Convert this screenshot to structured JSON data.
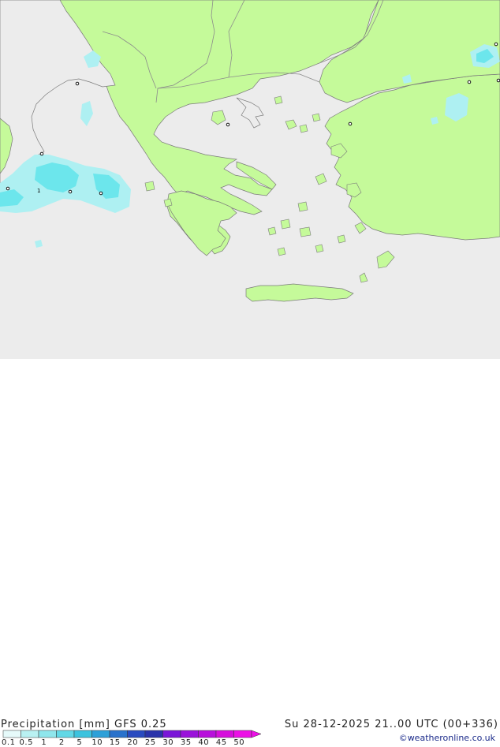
{
  "map": {
    "region": "Greece / Aegean / Western Turkey",
    "colors": {
      "sea": "#ececec",
      "land": "#c5fa9a",
      "border": "#8c8c8c",
      "coast": "#7a7a7a",
      "precip_light": "#aef0f2",
      "precip_medium": "#6ce6ec"
    },
    "markers": [
      "o",
      "o",
      "o",
      "o",
      "1",
      "o",
      "o",
      "o",
      "o",
      "o"
    ]
  },
  "footer": {
    "title": "Precipitation [mm]  GFS 0.25",
    "datetime": "Su 28-12-2025 21..00 UTC (00+336)",
    "credit": "©weatheronline.co.uk"
  },
  "legend": {
    "ticks": [
      "0.1",
      "0.5",
      "1",
      "2",
      "5",
      "10",
      "15",
      "20",
      "25",
      "30",
      "35",
      "40",
      "45",
      "50"
    ],
    "colors": [
      "#e6fafa",
      "#b9f1f2",
      "#8fe6ec",
      "#62d8e6",
      "#3cc3de",
      "#2da0d8",
      "#2a72cc",
      "#2a4bc0",
      "#2a33aa",
      "#7a16d8",
      "#9a12da",
      "#b810dc",
      "#d60edc",
      "#ec10e6"
    ]
  }
}
